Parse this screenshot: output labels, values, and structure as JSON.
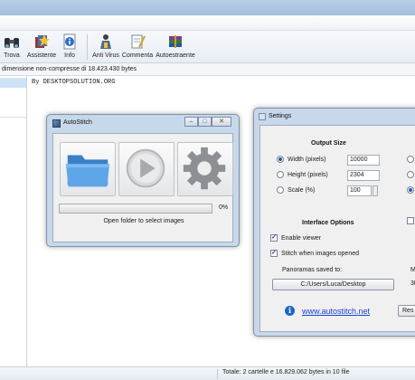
{
  "toolbar": {
    "items": [
      {
        "label": "Trova",
        "icon": "binoculars-icon"
      },
      {
        "label": "Assistente",
        "icon": "wizard-icon"
      },
      {
        "label": "Info",
        "icon": "info-icon"
      },
      {
        "label": "Anti Virus",
        "icon": "antivirus-icon"
      },
      {
        "label": "Commenta",
        "icon": "comment-icon"
      },
      {
        "label": "Autoestraente",
        "icon": "sfx-icon"
      }
    ]
  },
  "info_bar": {
    "text": "dimensione non-compresse di 18.423.430 bytes"
  },
  "comment": {
    "text": "By DESKTOPSOLUTION.ORG"
  },
  "status_bar": {
    "text": "Totale: 2 cartelle e 16.829.062 bytes in 10 file"
  },
  "autostitch": {
    "title": "AutoStitch",
    "progress_percent": 0,
    "progress_label": "0%",
    "message": "Open folder to select images",
    "accent_progress": "#37b24d"
  },
  "settings": {
    "title": "Settings",
    "output_size": {
      "heading": "Output Size",
      "width_label": "Width (pixels)",
      "width_value": "10000",
      "height_label": "Height (pixels)",
      "height_value": "2304",
      "scale_label": "Scale (%)",
      "scale_value": "100",
      "selected": "width"
    },
    "interface_options": {
      "heading": "Interface Options",
      "enable_viewer": "Enable viewer",
      "enable_viewer_checked": true,
      "stitch_when_opened": "Stitch when images opened",
      "stitch_when_opened_checked": true
    },
    "panoramas_saved_to": "Panoramas saved to:",
    "path_button": "C:/Users/Luca/Desktop",
    "website": "www.autostitch.net",
    "cut_right": {
      "m_label": "M",
      "three_label": "3F",
      "reset_partial": "Res"
    }
  }
}
